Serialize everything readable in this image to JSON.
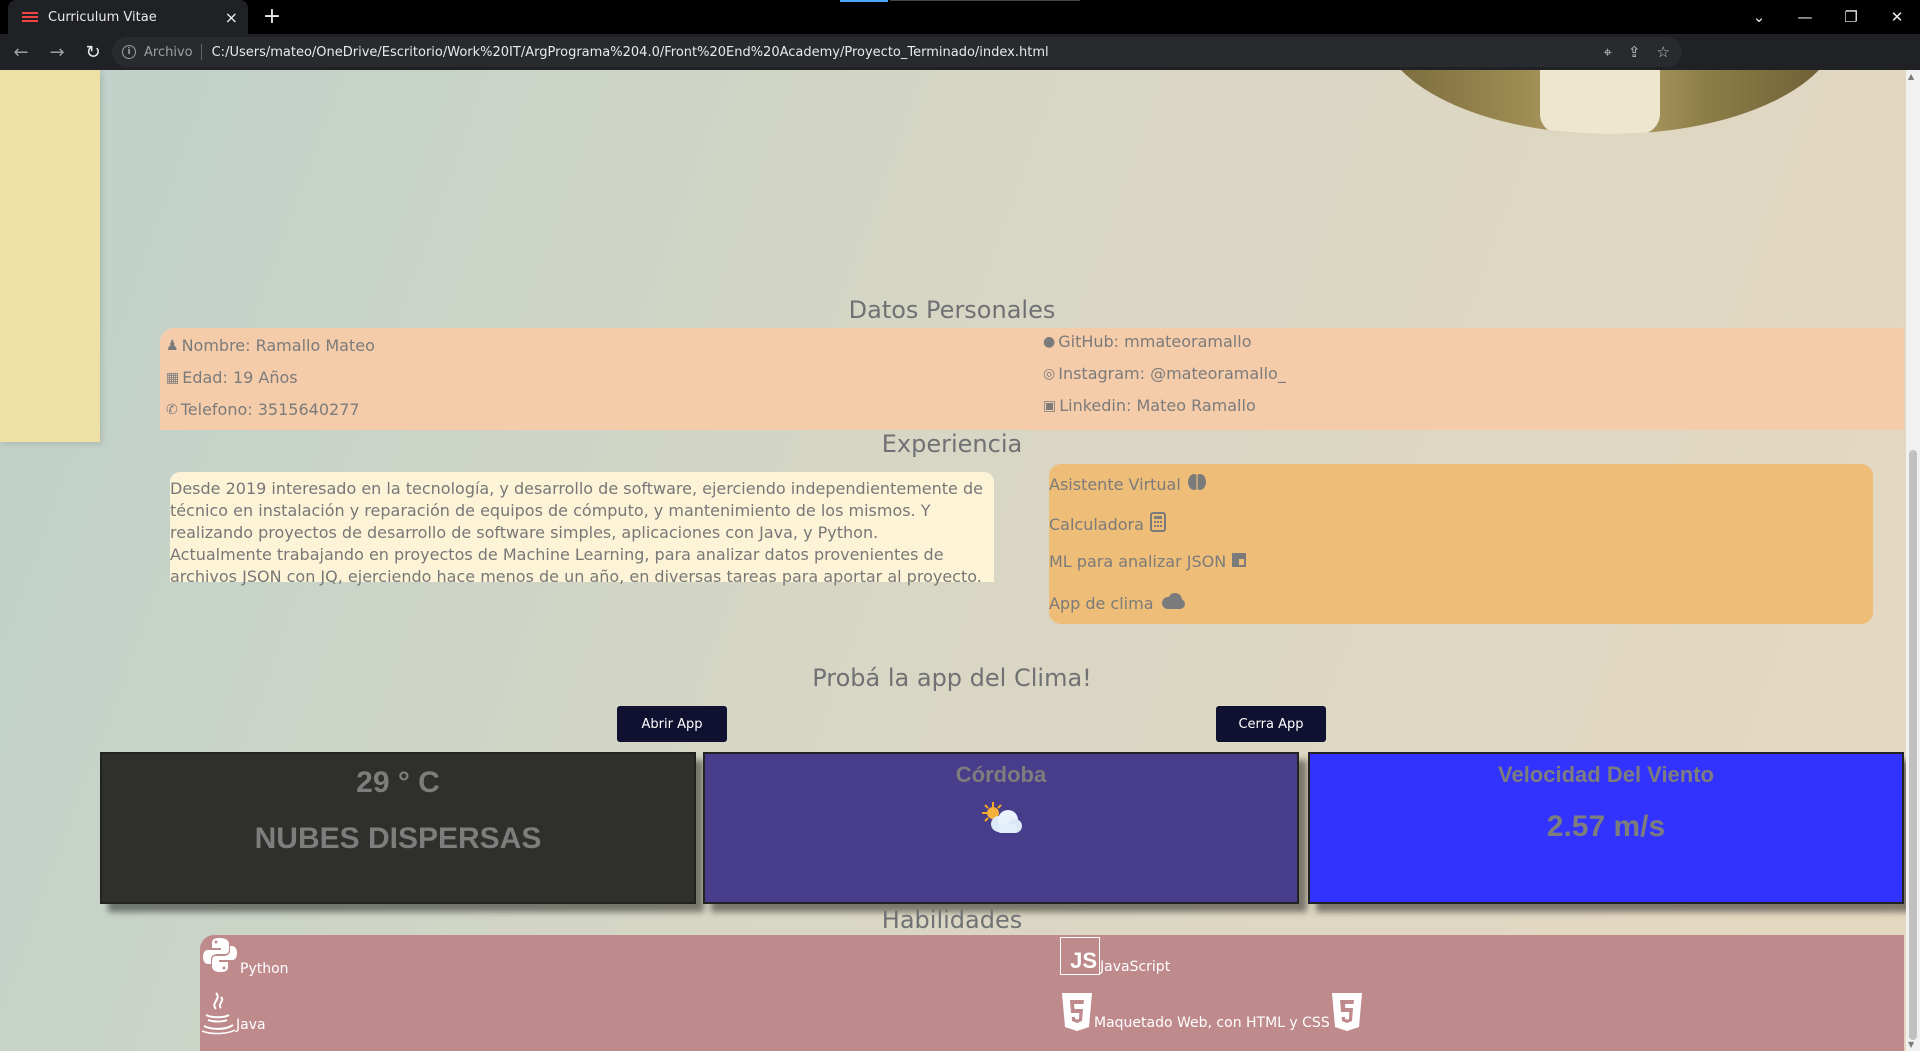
{
  "browser": {
    "tab_title": "Curriculum Vitae",
    "tab_close": "×",
    "new_tab": "+",
    "omnibox_label": "Archivo",
    "url": "C:/Users/mateo/OneDrive/Escritorio/Work%20IT/ArgPrograma%204.0/Front%20End%20Academy/Proyecto_Terminado/index.html",
    "window_controls": [
      "⌄",
      "—",
      "❐",
      "✕"
    ]
  },
  "personal": {
    "title": "Datos Personales",
    "nombre": "Nombre: Ramallo Mateo",
    "edad": "Edad: 19 Años",
    "telefono": "Telefono: 3515640277",
    "github": "GitHub: mmateoramallo",
    "instagram": "Instagram: @mateoramallo_",
    "linkedin": "Linkedin: Mateo Ramallo"
  },
  "experience": {
    "title": "Experiencia",
    "paragraph1": "Desde 2019 interesado en la tecnología, y desarrollo de software, ejerciendo independientemente de técnico en instalación y reparación de equipos de cómputo, y mantenimiento de los mismos. Y realizando proyectos de desarrollo de software simples, aplicaciones con Java, y Python.",
    "paragraph2": "Actualmente trabajando en proyectos de Machine Learning, para analizar datos provenientes de archivos JSON con JQ, ejerciendo hace menos de un año, en diversas tareas para aportar al proyecto.",
    "projects": [
      {
        "label": "Asistente Virtual",
        "icon": "brain-icon"
      },
      {
        "label": "Calculadora",
        "icon": "calculator-icon"
      },
      {
        "label": "ML para analizar JSON",
        "icon": "json-icon"
      },
      {
        "label": "App de clima",
        "icon": "cloud-icon"
      }
    ]
  },
  "weather": {
    "title": "Probá la app del Clima!",
    "open_button": "Abrir App",
    "close_button": "Cerra App",
    "temperature": "29 ° C",
    "description": "NUBES DISPERSAS",
    "city": "Córdoba",
    "wind_label": "Velocidad Del Viento",
    "wind_value": "2.57 m/s",
    "card_colors": [
      "#2f2f2c",
      "#483d8b",
      "#3333ff"
    ]
  },
  "skills": {
    "title": "Habilidades",
    "items": [
      {
        "label": "Python",
        "icon": "python-icon"
      },
      {
        "label": "JavaScript",
        "icon": "javascript-icon"
      },
      {
        "label": "Java",
        "icon": "java-icon"
      },
      {
        "label": "Maquetado Web, con HTML y CSS",
        "icon": "html5-css3-icon"
      }
    ],
    "js_badge": "JS"
  }
}
